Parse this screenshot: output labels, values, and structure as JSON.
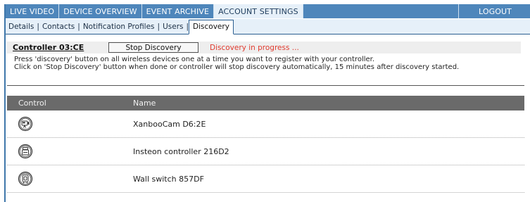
{
  "nav": {
    "tabs": [
      "LIVE VIDEO",
      "DEVICE OVERVIEW",
      "EVENT ARCHIVE",
      "ACCOUNT SETTINGS"
    ],
    "active_tab": "ACCOUNT SETTINGS",
    "logout": "LOGOUT"
  },
  "subnav": {
    "items": [
      "Details",
      "Contacts",
      "Notification Profiles",
      "Users",
      "Discovery"
    ],
    "active": "Discovery"
  },
  "discovery": {
    "controller": "Controller 03:CE",
    "stop_button": "Stop Discovery",
    "status": "Discovery in progress ...",
    "status_color": "#e03a2e",
    "help_line1": "Press 'discovery' button on all wireless devices one at a time you want to register with your controller.",
    "help_line2": "Click on 'Stop Discovery' button when done or controller will stop discovery automatically, 15 minutes after discovery started."
  },
  "table": {
    "headers": [
      "Control",
      "Name"
    ],
    "rows": [
      {
        "icon": "camera-device-icon",
        "name": "XanbooCam D6:2E"
      },
      {
        "icon": "controller-device-icon",
        "name": "Insteon controller 216D2"
      },
      {
        "icon": "switch-device-icon",
        "name": "Wall switch 857DF"
      }
    ]
  },
  "colors": {
    "nav_bg": "#4e86bb",
    "active_bg": "#e6f0f9",
    "header_bg": "#6a6a6a"
  }
}
